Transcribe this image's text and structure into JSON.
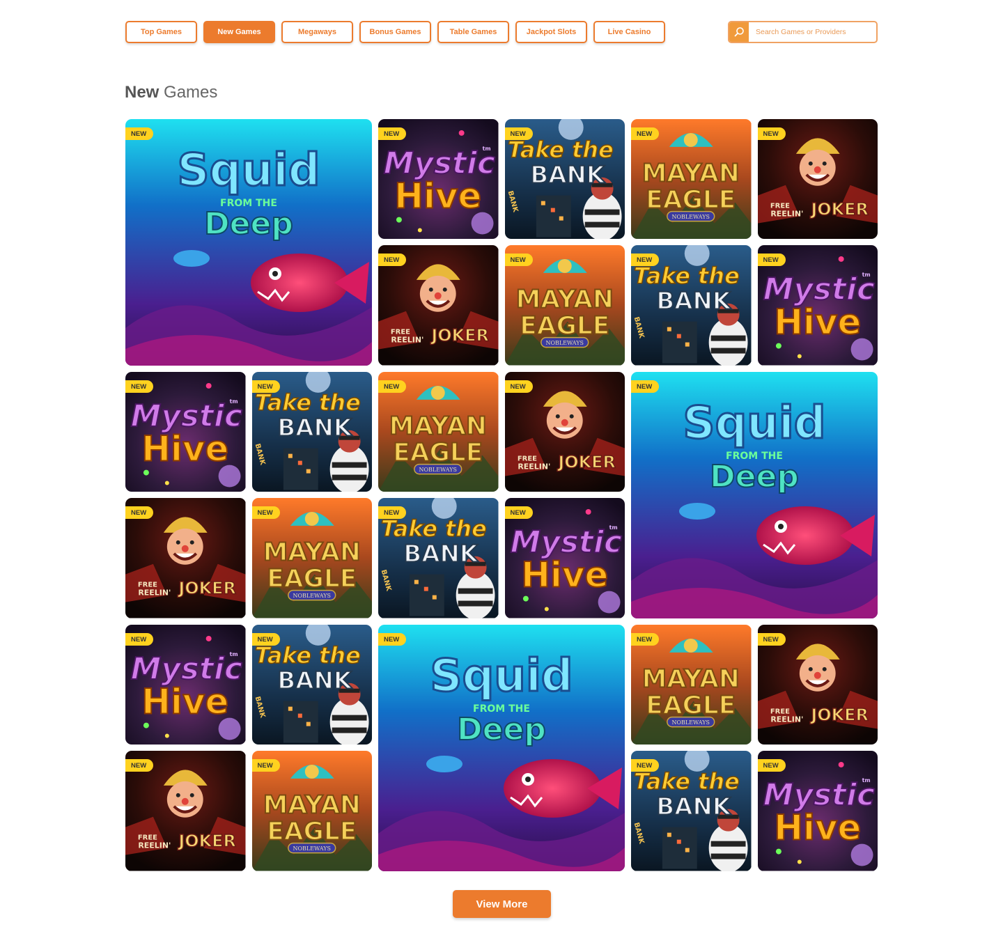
{
  "nav": {
    "tabs": [
      {
        "label": "Top Games",
        "active": false
      },
      {
        "label": "New Games",
        "active": true
      },
      {
        "label": "Megaways",
        "active": false
      },
      {
        "label": "Bonus Games",
        "active": false
      },
      {
        "label": "Table Games",
        "active": false
      },
      {
        "label": "Jackpot Slots",
        "active": false
      },
      {
        "label": "Live Casino",
        "active": false
      }
    ],
    "search": {
      "placeholder": "Search Games or Providers",
      "icon": "search-icon"
    }
  },
  "section": {
    "title_strong": "New",
    "title_rest": " Games"
  },
  "badge_label": "NEW",
  "games": {
    "squid": {
      "title_line1": "Squid",
      "title_line2": "FROM THE",
      "title_line3": "Deep"
    },
    "mystic": {
      "title_line1": "Mystic",
      "title_line2": "Hive",
      "tm": "tm"
    },
    "bank": {
      "title_line1": "Take the",
      "title_line2": "BANK",
      "sign": "BANK"
    },
    "mayan": {
      "title_line1": "MAYAN",
      "title_line2": "EAGLE",
      "subtitle": "NOBLEWAYS"
    },
    "joker": {
      "title_line1": "FREE",
      "title_line2": "REELIN'",
      "title_line3": "JOKER"
    }
  },
  "tiles": [
    {
      "game": "squid",
      "size": "large"
    },
    {
      "game": "mystic",
      "size": "small"
    },
    {
      "game": "bank",
      "size": "small"
    },
    {
      "game": "mayan",
      "size": "small"
    },
    {
      "game": "joker",
      "size": "small"
    },
    {
      "game": "joker",
      "size": "small"
    },
    {
      "game": "mayan",
      "size": "small"
    },
    {
      "game": "bank",
      "size": "small"
    },
    {
      "game": "mystic",
      "size": "small"
    },
    {
      "game": "mystic",
      "size": "small"
    },
    {
      "game": "bank",
      "size": "small"
    },
    {
      "game": "mayan",
      "size": "small"
    },
    {
      "game": "joker",
      "size": "small"
    },
    {
      "game": "squid",
      "size": "large"
    },
    {
      "game": "joker",
      "size": "small"
    },
    {
      "game": "mayan",
      "size": "small"
    },
    {
      "game": "bank",
      "size": "small"
    },
    {
      "game": "mystic",
      "size": "small"
    },
    {
      "game": "mystic",
      "size": "small"
    },
    {
      "game": "bank",
      "size": "small"
    },
    {
      "game": "squid",
      "size": "large"
    },
    {
      "game": "mayan",
      "size": "small"
    },
    {
      "game": "joker",
      "size": "small"
    },
    {
      "game": "joker",
      "size": "small"
    },
    {
      "game": "mayan",
      "size": "small"
    },
    {
      "game": "bank",
      "size": "small"
    },
    {
      "game": "mystic",
      "size": "small"
    }
  ],
  "view_more_label": "View More",
  "colors": {
    "accent": "#ec7b2d",
    "badge": "#ffd21f"
  }
}
